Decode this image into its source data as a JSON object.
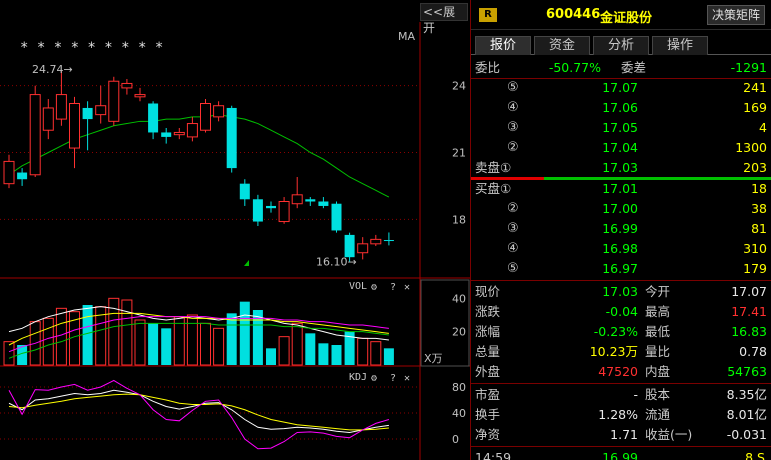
{
  "stock": {
    "code": "600446",
    "name": "金证股份",
    "badge": "R",
    "decision_button": "决策矩阵"
  },
  "toolbar": {
    "expand_label": "<<展开"
  },
  "tabs": [
    "报价",
    "资金",
    "分析",
    "操作"
  ],
  "order_book": {
    "weibi_label": "委比",
    "weibi_value": "-50.77%",
    "weicha_label": "委差",
    "weicha_value": "-1291",
    "sell": [
      {
        "level": "⑤",
        "price": "17.07",
        "volume": "241"
      },
      {
        "level": "④",
        "price": "17.06",
        "volume": "169"
      },
      {
        "level": "③",
        "price": "17.05",
        "volume": "4"
      },
      {
        "level": "②",
        "price": "17.04",
        "volume": "1300"
      },
      {
        "level": "卖盘①",
        "price": "17.03",
        "volume": "203"
      }
    ],
    "buy": [
      {
        "level": "买盘①",
        "price": "17.01",
        "volume": "18"
      },
      {
        "level": "②",
        "price": "17.00",
        "volume": "38"
      },
      {
        "level": "③",
        "price": "16.99",
        "volume": "81"
      },
      {
        "level": "④",
        "price": "16.98",
        "volume": "310"
      },
      {
        "level": "⑤",
        "price": "16.97",
        "volume": "179"
      }
    ]
  },
  "quote": [
    {
      "l1": "现价",
      "v1": "17.03",
      "c1": "grn",
      "l2": "今开",
      "v2": "17.07",
      "c2": "wht"
    },
    {
      "l1": "涨跌",
      "v1": "-0.04",
      "c1": "grn",
      "l2": "最高",
      "v2": "17.41",
      "c2": "red"
    },
    {
      "l1": "涨幅",
      "v1": "-0.23%",
      "c1": "grn",
      "l2": "最低",
      "v2": "16.83",
      "c2": "grn"
    },
    {
      "l1": "总量",
      "v1": "10.23万",
      "c1": "ylw",
      "l2": "量比",
      "v2": "0.78",
      "c2": "wht"
    },
    {
      "l1": "外盘",
      "v1": "47520",
      "c1": "red",
      "l2": "内盘",
      "v2": "54763",
      "c2": "grn"
    }
  ],
  "fundamentals": [
    {
      "l1": "市盈",
      "v1": "-",
      "l2": "股本",
      "v2": "8.35亿"
    },
    {
      "l1": "换手",
      "v1": "1.28%",
      "l2": "流通",
      "v2": "8.01亿"
    },
    {
      "l1": "净资",
      "v1": "1.71",
      "l2": "收益(一)",
      "v2": "-0.031"
    }
  ],
  "last_tick": {
    "time": "14:59",
    "price": "16.99",
    "volume": "8",
    "side": "S"
  },
  "chart": {
    "ma_label": "MA",
    "price_high_label": "24.74→",
    "price_low_label": "16.10→",
    "price_ticks": [
      "24",
      "21",
      "18"
    ],
    "vol_label": "VOL",
    "vol_ticks": [
      "40",
      "20"
    ],
    "vol_unit": "X万",
    "kdj_label": "KDJ",
    "kdj_ticks": [
      "80",
      "40",
      "0"
    ],
    "gear_icon": "⚙",
    "help_icon": "?",
    "close_icon": "✕",
    "stars": "* *  * * *   * *      *    *"
  },
  "chart_data": {
    "type": "candlestick",
    "price_ylim": [
      15.5,
      26.5
    ],
    "candles": [
      {
        "o": 19.6,
        "c": 20.6,
        "h": 20.9,
        "l": 19.4
      },
      {
        "o": 20.1,
        "c": 19.8,
        "h": 20.3,
        "l": 19.5
      },
      {
        "o": 20.0,
        "c": 23.6,
        "h": 24.0,
        "l": 19.9
      },
      {
        "o": 22.0,
        "c": 23.0,
        "h": 23.4,
        "l": 21.6
      },
      {
        "o": 22.5,
        "c": 23.6,
        "h": 24.7,
        "l": 22.2
      },
      {
        "o": 21.2,
        "c": 23.2,
        "h": 23.5,
        "l": 20.3
      },
      {
        "o": 23.0,
        "c": 22.5,
        "h": 23.3,
        "l": 21.1
      },
      {
        "o": 22.7,
        "c": 23.1,
        "h": 24.0,
        "l": 22.3
      },
      {
        "o": 22.4,
        "c": 24.2,
        "h": 24.4,
        "l": 22.2
      },
      {
        "o": 23.9,
        "c": 24.1,
        "h": 24.3,
        "l": 23.6
      },
      {
        "o": 23.5,
        "c": 23.6,
        "h": 23.9,
        "l": 23.3
      },
      {
        "o": 23.2,
        "c": 21.9,
        "h": 23.3,
        "l": 21.6
      },
      {
        "o": 21.9,
        "c": 21.7,
        "h": 22.1,
        "l": 21.4
      },
      {
        "o": 21.8,
        "c": 21.9,
        "h": 22.1,
        "l": 21.6
      },
      {
        "o": 21.7,
        "c": 22.3,
        "h": 22.6,
        "l": 21.5
      },
      {
        "o": 22.0,
        "c": 23.2,
        "h": 23.4,
        "l": 21.9
      },
      {
        "o": 22.6,
        "c": 23.1,
        "h": 23.3,
        "l": 22.4
      },
      {
        "o": 23.0,
        "c": 20.3,
        "h": 23.1,
        "l": 20.1
      },
      {
        "o": 19.6,
        "c": 18.9,
        "h": 19.8,
        "l": 18.6
      },
      {
        "o": 18.9,
        "c": 17.9,
        "h": 19.1,
        "l": 17.7
      },
      {
        "o": 18.6,
        "c": 18.5,
        "h": 18.8,
        "l": 18.3
      },
      {
        "o": 17.9,
        "c": 18.8,
        "h": 19.0,
        "l": 17.8
      },
      {
        "o": 18.7,
        "c": 19.1,
        "h": 19.9,
        "l": 18.5
      },
      {
        "o": 18.9,
        "c": 18.8,
        "h": 19.0,
        "l": 18.6
      },
      {
        "o": 18.8,
        "c": 18.6,
        "h": 19.0,
        "l": 18.5
      },
      {
        "o": 18.7,
        "c": 17.5,
        "h": 18.8,
        "l": 17.4
      },
      {
        "o": 17.3,
        "c": 16.3,
        "h": 17.4,
        "l": 16.1
      },
      {
        "o": 16.5,
        "c": 16.9,
        "h": 17.2,
        "l": 16.2
      },
      {
        "o": 16.9,
        "c": 17.1,
        "h": 17.3,
        "l": 16.8
      },
      {
        "o": 17.07,
        "c": 17.03,
        "h": 17.41,
        "l": 16.83
      }
    ],
    "ma_line": [
      20.0,
      20.4,
      20.7,
      21.0,
      21.3,
      21.6,
      21.8,
      22.0,
      22.2,
      22.3,
      22.4,
      22.4,
      22.5,
      22.5,
      22.6,
      22.6,
      22.7,
      22.6,
      22.5,
      22.3,
      22.0,
      21.7,
      21.4,
      21.0,
      20.7,
      20.3,
      19.9,
      19.6,
      19.3,
      19.0
    ],
    "vol_ylim": [
      0,
      48
    ],
    "volumes": [
      14,
      12,
      26,
      28,
      34,
      32,
      36,
      35,
      40,
      39,
      27,
      25,
      22,
      29,
      30,
      25,
      22,
      31,
      38,
      33,
      10,
      17,
      25,
      19,
      13,
      12,
      20,
      16,
      14,
      10
    ],
    "vol_ma1": [
      20,
      22,
      26,
      29,
      31,
      33,
      34,
      35,
      34,
      32,
      30,
      28,
      27,
      28,
      29,
      28,
      27,
      28,
      30,
      29,
      27,
      25,
      24,
      22,
      20,
      18,
      17,
      16,
      16,
      15
    ],
    "vol_ma2": [
      12,
      16,
      19,
      22,
      25,
      27,
      29,
      30,
      31,
      31,
      31,
      30,
      29,
      29,
      28,
      28,
      28,
      27,
      27,
      27,
      27,
      26,
      26,
      25,
      24,
      23,
      22,
      21,
      20,
      19
    ],
    "vol_ma3": [
      8,
      11,
      13,
      16,
      18,
      21,
      23,
      25,
      27,
      28,
      29,
      29,
      29,
      29,
      29,
      29,
      28,
      28,
      28,
      28,
      28,
      27,
      27,
      26,
      26,
      25,
      24,
      24,
      23,
      22
    ],
    "kdj_ylim": [
      -20,
      100
    ],
    "kdj_k": [
      55,
      45,
      60,
      62,
      66,
      70,
      68,
      70,
      75,
      72,
      68,
      58,
      50,
      46,
      50,
      55,
      56,
      45,
      30,
      18,
      15,
      16,
      18,
      17,
      15,
      12,
      10,
      14,
      18,
      21
    ],
    "kdj_d": [
      50,
      48,
      52,
      55,
      58,
      62,
      64,
      66,
      68,
      69,
      68,
      64,
      60,
      55,
      53,
      53,
      54,
      51,
      45,
      37,
      30,
      26,
      22,
      20,
      18,
      16,
      14,
      14,
      15,
      17
    ],
    "kdj_j": [
      75,
      38,
      76,
      75,
      80,
      84,
      75,
      80,
      90,
      78,
      68,
      45,
      30,
      28,
      44,
      58,
      60,
      33,
      0,
      -15,
      -14,
      -4,
      10,
      11,
      9,
      4,
      2,
      14,
      24,
      30
    ]
  }
}
